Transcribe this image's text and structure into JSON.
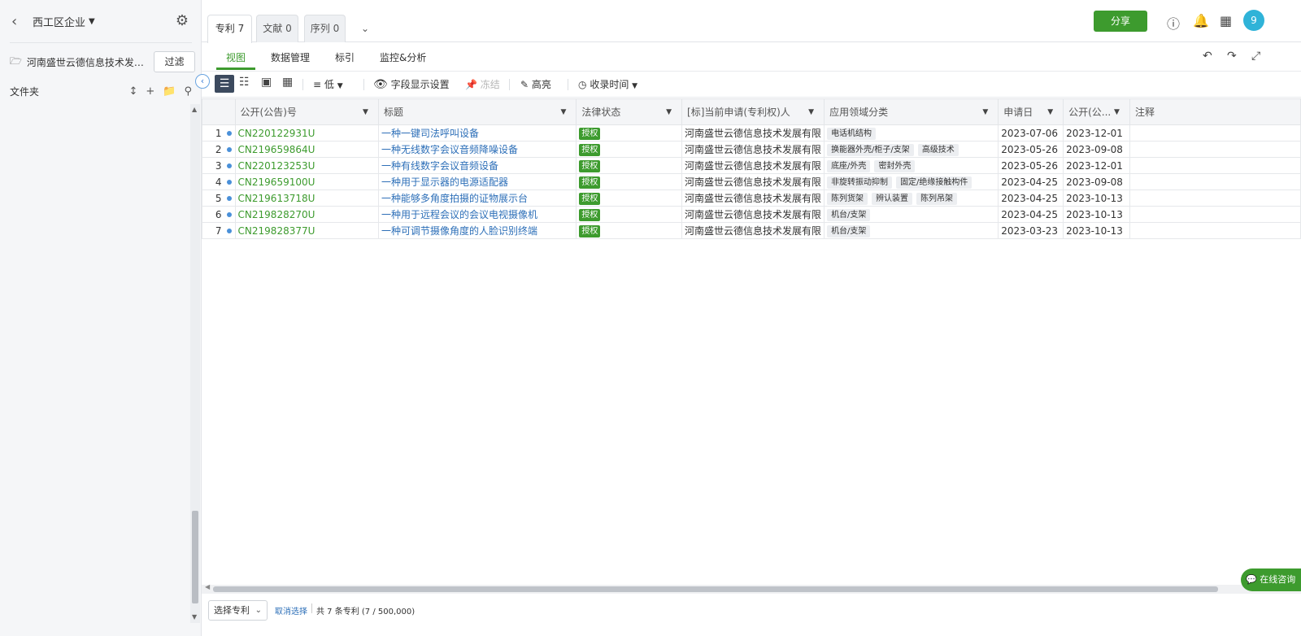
{
  "sidebar": {
    "back_icon": "chevron-left-icon",
    "title": "西工区企业",
    "project_name": "河南盛世云德信息技术发展...",
    "filter_label": "过滤",
    "folder_label": "文件夹"
  },
  "top_tabs": [
    {
      "label": "专利 7",
      "active": true
    },
    {
      "label": "文献 0",
      "active": false
    },
    {
      "label": "序列 0",
      "active": false
    }
  ],
  "header": {
    "share_label": "分享",
    "avatar_text": "9"
  },
  "subnav": [
    {
      "label": "视图",
      "active": true
    },
    {
      "label": "数据管理",
      "active": false
    },
    {
      "label": "标引",
      "active": false
    },
    {
      "label": "监控&分析",
      "active": false
    }
  ],
  "toolbar": {
    "density_label": "低",
    "field_display_label": "字段显示设置",
    "freeze_label": "冻结",
    "highlight_label": "高亮",
    "sort_label": "收录时间"
  },
  "table": {
    "columns": [
      "公开(公告)号",
      "标题",
      "法律状态",
      "[标]当前申请(专利权)人",
      "应用领域分类",
      "申请日",
      "公开(公...",
      "注释"
    ],
    "rows": [
      {
        "idx": "1",
        "pn": "CN220122931U",
        "title": "一种一键司法呼叫设备",
        "status": "授权",
        "applicant": "河南盛世云德信息技术发展有限",
        "fields": [
          "电话机结构"
        ],
        "app_date": "2023-07-06",
        "pub_date": "2023-12-01",
        "note": ""
      },
      {
        "idx": "2",
        "pn": "CN219659864U",
        "title": "一种无线数字会议音频降噪设备",
        "status": "授权",
        "applicant": "河南盛世云德信息技术发展有限",
        "fields": [
          "换能器外壳/柜子/支架",
          "高级技术"
        ],
        "app_date": "2023-05-26",
        "pub_date": "2023-09-08",
        "note": ""
      },
      {
        "idx": "3",
        "pn": "CN220123253U",
        "title": "一种有线数字会议音频设备",
        "status": "授权",
        "applicant": "河南盛世云德信息技术发展有限",
        "fields": [
          "底座/外壳",
          "密封外壳"
        ],
        "app_date": "2023-05-26",
        "pub_date": "2023-12-01",
        "note": ""
      },
      {
        "idx": "4",
        "pn": "CN219659100U",
        "title": "一种用于显示器的电源适配器",
        "status": "授权",
        "applicant": "河南盛世云德信息技术发展有限",
        "fields": [
          "非旋转振动抑制",
          "固定/绝缘接触构件"
        ],
        "app_date": "2023-04-25",
        "pub_date": "2023-09-08",
        "note": ""
      },
      {
        "idx": "5",
        "pn": "CN219613718U",
        "title": "一种能够多角度拍摄的证物展示台",
        "status": "授权",
        "applicant": "河南盛世云德信息技术发展有限",
        "fields": [
          "陈列货架",
          "辨认装置",
          "陈列吊架"
        ],
        "app_date": "2023-04-25",
        "pub_date": "2023-10-13",
        "note": ""
      },
      {
        "idx": "6",
        "pn": "CN219828270U",
        "title": "一种用于远程会议的会议电视摄像机",
        "status": "授权",
        "applicant": "河南盛世云德信息技术发展有限",
        "fields": [
          "机台/支架"
        ],
        "app_date": "2023-04-25",
        "pub_date": "2023-10-13",
        "note": ""
      },
      {
        "idx": "7",
        "pn": "CN219828377U",
        "title": "一种可调节摄像角度的人脸识别终端",
        "status": "授权",
        "applicant": "河南盛世云德信息技术发展有限",
        "fields": [
          "机台/支架"
        ],
        "app_date": "2023-03-23",
        "pub_date": "2023-10-13",
        "note": ""
      }
    ]
  },
  "footer": {
    "select_label": "选择专利",
    "cancel_label": "取消选择",
    "total_label": "共 7 条专利 (7 / 500,000)"
  },
  "chat_label": "在线咨询",
  "colors": {
    "brand_green": "#3d9b2e",
    "link_blue": "#2d6fb8",
    "toolbar_dark": "#3c4a5e",
    "avatar": "#2fb3d8"
  }
}
